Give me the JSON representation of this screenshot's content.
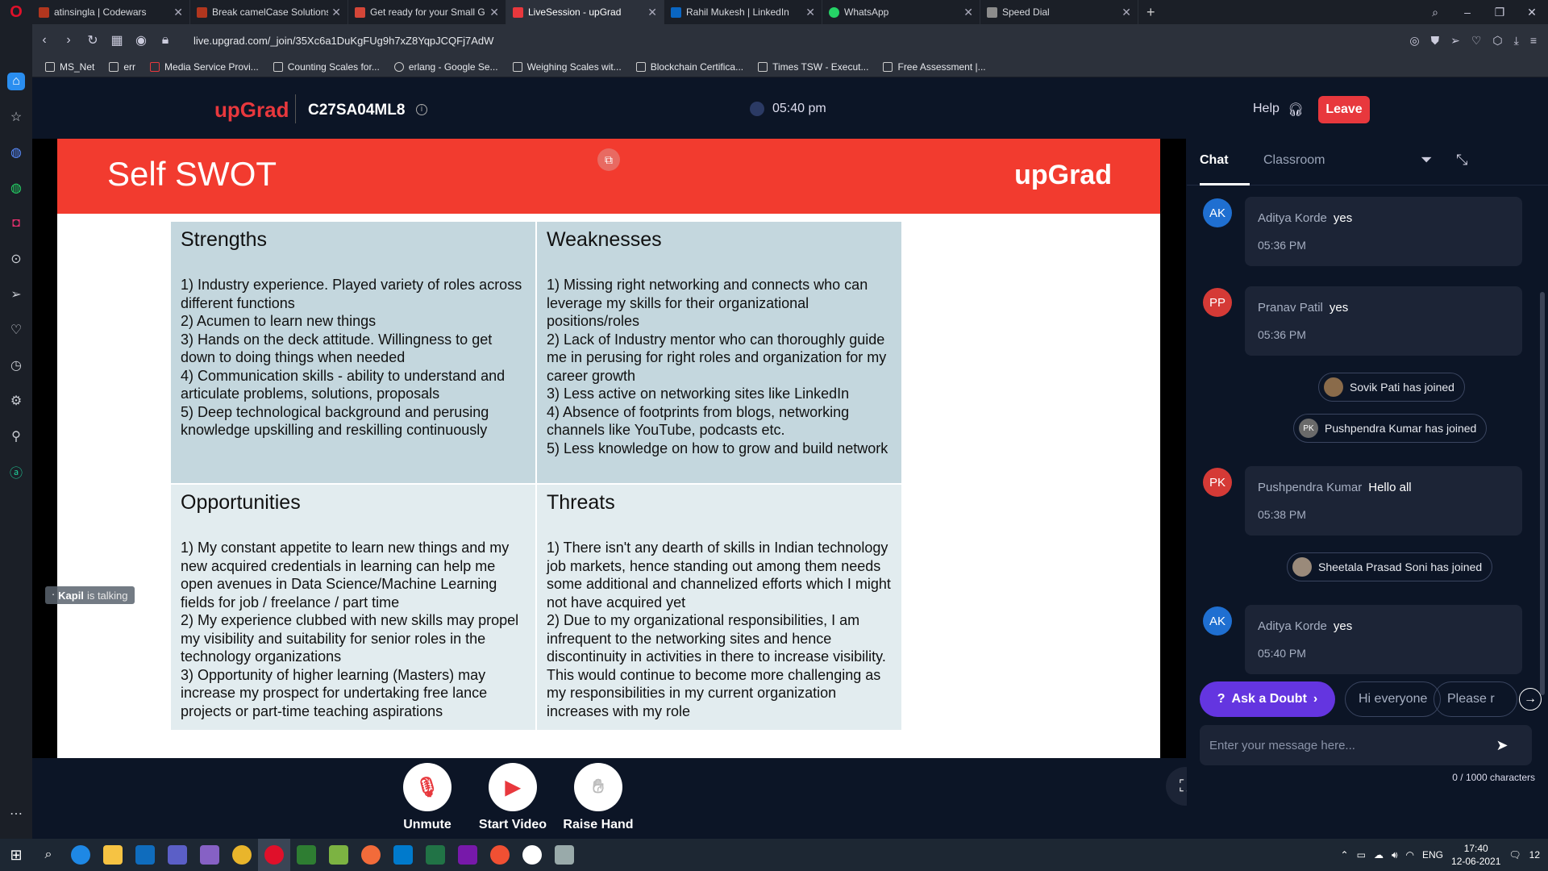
{
  "browser": {
    "tabs": [
      {
        "label": "atinsingla | Codewars",
        "color": "#b1361e"
      },
      {
        "label": "Break camelCase Solutions",
        "color": "#b1361e"
      },
      {
        "label": "Get ready for your Small G",
        "color": "#d44638"
      },
      {
        "label": "LiveSession - upGrad",
        "color": "#e8383d",
        "active": true
      },
      {
        "label": "Rahil Mukesh | LinkedIn",
        "color": "#0a66c2"
      },
      {
        "label": "WhatsApp",
        "color": "#25d366"
      },
      {
        "label": "Speed Dial",
        "color": "#8c8c8c"
      }
    ],
    "url": "live.upgrad.com/_join/35Xc6a1DuKgFUg9h7xZ8YqpJCQFj7AdW",
    "bookmarks": [
      "MS_Net",
      "err",
      "Media Service Provi...",
      "Counting Scales for...",
      "erlang - Google Se...",
      "Weighing Scales wit...",
      "Blockchain Certifica...",
      "Times TSW - Execut...",
      "Free Assessment |..."
    ]
  },
  "header": {
    "brand": "upGrad",
    "session_id": "C27SA04ML8",
    "time": "05:40 pm",
    "help_label": "Help",
    "leave_label": "Leave"
  },
  "slide": {
    "title": "Self SWOT",
    "brand": "upGrad",
    "strengths": {
      "title": "Strengths",
      "body": "1) Industry experience. Played variety of roles across different functions\n2) Acumen to learn new things\n3) Hands on the deck attitude. Willingness to get down to doing things when needed\n4) Communication skills - ability to understand and articulate problems, solutions, proposals\n5) Deep technological background and perusing knowledge upskilling and reskilling continuously"
    },
    "weaknesses": {
      "title": "Weaknesses",
      "body": "1) Missing right networking and connects who can leverage my skills for their organizational positions/roles\n2) Lack of Industry mentor who can thoroughly guide me in perusing for right roles and organization for my career growth\n3) Less active on networking sites like LinkedIn\n4) Absence of footprints from blogs, networking channels like YouTube, podcasts etc.\n5) Less knowledge on how to grow and build network"
    },
    "opportunities": {
      "title": "Opportunities",
      "body": "1) My constant appetite to learn new things and my new acquired credentials in learning can help me open avenues in Data Science/Machine Learning fields for job / freelance / part time\n2) My experience clubbed with new skills may propel my visibility and suitability for senior roles in the technology organizations\n3) Opportunity of higher learning (Masters) may increase my prospect for undertaking free lance projects or part-time teaching aspirations"
    },
    "threats": {
      "title": "Threats",
      "body": "1) There isn't any dearth of skills in Indian technology job markets, hence standing out among them needs some additional and channelized efforts which I might not have acquired yet\n2) Due to my organizational responsibilities, I am infrequent to the networking sites and hence discontinuity in activities in there to increase visibility. This would continue to become more challenging as my responsibilities in my current organization increases with my role"
    }
  },
  "talking": {
    "name": "Kapil",
    "suffix": "is talking"
  },
  "controls": {
    "unmute": "Unmute",
    "start_video": "Start Video",
    "raise_hand": "Raise Hand"
  },
  "chat": {
    "tab_chat": "Chat",
    "tab_classroom": "Classroom",
    "messages": [
      {
        "initials": "AK",
        "sender": "Aditya Korde",
        "text": "yes",
        "time": "05:36 PM",
        "color": "#1f6fd1"
      },
      {
        "initials": "PP",
        "sender": "Pranav Patil",
        "text": "yes",
        "time": "05:36 PM",
        "color": "#d53a36"
      },
      {
        "initials": "PK",
        "sender": "Pushpendra Kumar",
        "text": "Hello all",
        "time": "05:38 PM",
        "color": "#d53a36"
      },
      {
        "initials": "AK",
        "sender": "Aditya Korde",
        "text": "yes",
        "time": "05:40 PM",
        "color": "#1f6fd1"
      }
    ],
    "joins": [
      {
        "initials": "",
        "text": "Sovik Pati has joined"
      },
      {
        "initials": "PK",
        "text": "Pushpendra Kumar has joined"
      },
      {
        "initials": "",
        "text": "Sheetala Prasad Soni has joined"
      }
    ],
    "ask_doubt": "Ask a Doubt",
    "quick_replies": [
      "Hi everyone",
      "Please r"
    ],
    "input_placeholder": "Enter your message here...",
    "char_count": "0 / 1000 characters"
  },
  "taskbar": {
    "language": "ENG",
    "time": "17:40",
    "date": "12-06-2021",
    "notifications": "12"
  }
}
